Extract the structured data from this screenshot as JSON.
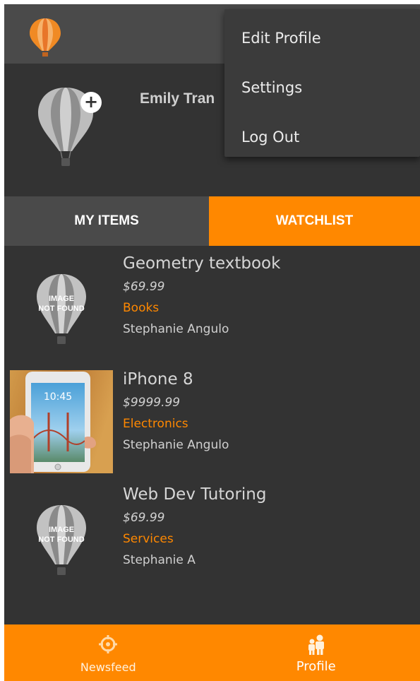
{
  "app": {
    "logo_icon": "hot-air-balloon-icon",
    "accent_color": "#ff8800"
  },
  "menu": {
    "items": [
      {
        "label": "Edit Profile"
      },
      {
        "label": "Settings"
      },
      {
        "label": "Log Out"
      }
    ]
  },
  "profile": {
    "name": "Emily Tran",
    "avatar_icon": "balloon-placeholder-icon",
    "add_photo_icon": "plus-icon"
  },
  "tabs": [
    {
      "label": "MY ITEMS",
      "active": false
    },
    {
      "label": "WATCHLIST",
      "active": true
    }
  ],
  "placeholder_text": {
    "line1": "IMAGE",
    "line2": "NOT FOUND"
  },
  "items": [
    {
      "title": "Geometry textbook",
      "price": "$69.99",
      "category": "Books",
      "seller": "Stephanie Angulo",
      "thumbnail": "image-not-found"
    },
    {
      "title": "iPhone 8",
      "price": "$9999.99",
      "category": "Electronics",
      "seller": "Stephanie Angulo",
      "thumbnail": "phone-photo",
      "phone_time": "10:45"
    },
    {
      "title": "Web Dev Tutoring",
      "price": "$69.99",
      "category": "Services",
      "seller": "Stephanie A",
      "thumbnail": "image-not-found"
    }
  ],
  "bottom_nav": [
    {
      "label": "Newsfeed",
      "icon": "crosshair-icon"
    },
    {
      "label": "Profile",
      "icon": "people-icon"
    }
  ]
}
